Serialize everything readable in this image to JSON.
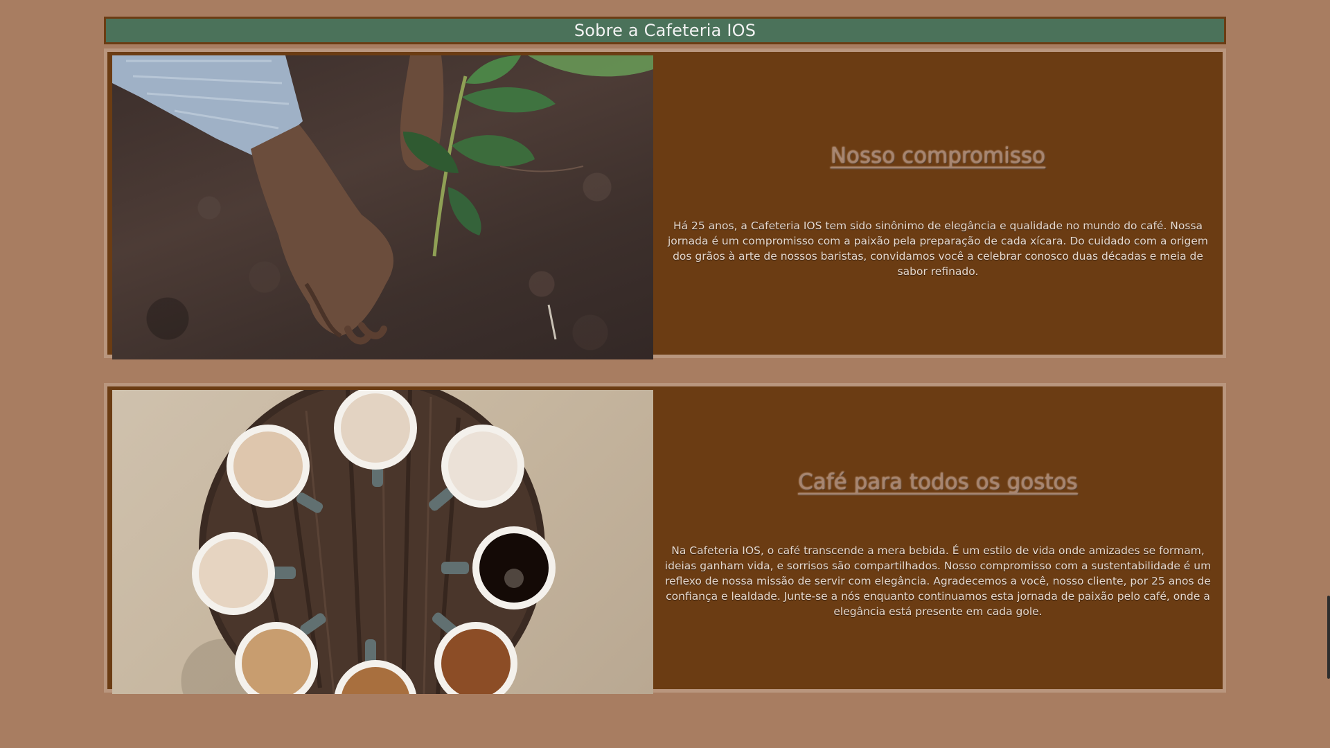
{
  "header": {
    "title": "Sobre a Cafeteria IOS"
  },
  "sections": [
    {
      "title": "Nosso compromisso",
      "body": "Há 25 anos, a Cafeteria IOS tem sido sinônimo de elegância e qualidade no mundo do café. Nossa jornada é um compromisso com a paixão pela preparação de cada xícara. Do cuidado com a origem dos grãos à arte de nossos baristas, convidamos você a celebrar conosco duas décadas e meia de sabor refinado.",
      "image": "hands-planting-coffee-seedling"
    },
    {
      "title": "Café para todos os gostos",
      "body": "Na Cafeteria IOS, o café transcende a mera bebida. É um estilo de vida onde amizades se formam, ideias ganham vida, e sorrisos são compartilhados. Nosso compromisso com a sustentabilidade é um reflexo de nossa missão de servir com elegância. Agradecemos a você, nosso cliente, por 25 anos de confiança e lealdade. Junte-se a nós enquanto continuamos esta jornada de paixão pelo café, onde a elegância está presente em cada gole.",
      "image": "coffee-cups-on-round-table"
    }
  ],
  "colors": {
    "page_background": "#a87d61",
    "header_background": "#4b725a",
    "section_background": "#6b3c13",
    "section_border": "#b9967e",
    "title_color": "#a78570",
    "body_color": "#e7d8cc"
  }
}
